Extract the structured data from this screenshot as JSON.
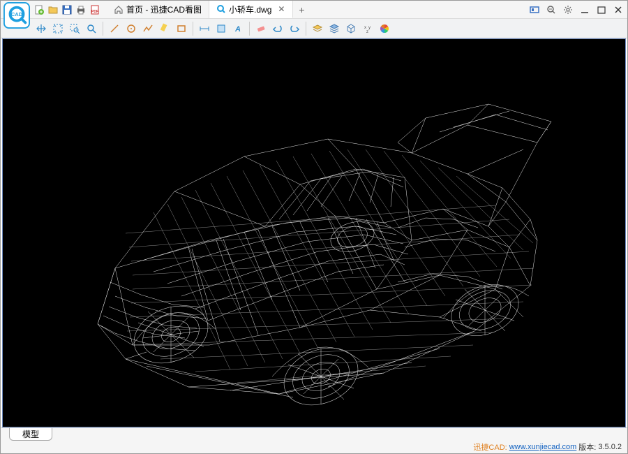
{
  "tabs": {
    "home": "首页 - 迅捷CAD看图",
    "file": "小轿车.dwg"
  },
  "bottom_tab": "模型",
  "status": {
    "brand": "迅捷CAD:",
    "url_text": "www.xunjiecad.com",
    "version_label": "版本:",
    "version": "3.5.0.2"
  }
}
